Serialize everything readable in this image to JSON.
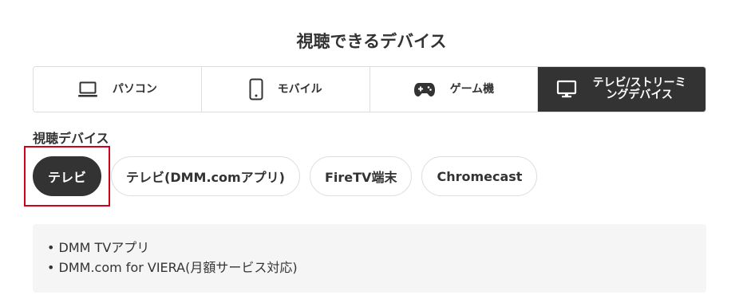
{
  "title": "視聴できるデバイス",
  "tabs": [
    {
      "label": "パソコン",
      "icon": "laptop-icon",
      "active": false
    },
    {
      "label": "モバイル",
      "icon": "smartphone-icon",
      "active": false
    },
    {
      "label": "ゲーム機",
      "icon": "gamepad-icon",
      "active": false
    },
    {
      "label": "テレビ/ストリーミングデバイス",
      "icon": "tv-monitor-icon",
      "active": true
    }
  ],
  "device_heading": "視聴デバイス",
  "chips": [
    {
      "label": "テレビ",
      "active": true
    },
    {
      "label": "テレビ(DMM.comアプリ)",
      "active": false
    },
    {
      "label": "FireTV端末",
      "active": false
    },
    {
      "label": "Chromecast",
      "active": false
    }
  ],
  "info_items": [
    "DMM TVアプリ",
    "DMM.com for VIERA(月額サービス対応)"
  ],
  "colors": {
    "active_bg": "#333333",
    "highlight": "#d0021b",
    "info_bg": "#f5f5f5",
    "border": "#dddddd"
  }
}
